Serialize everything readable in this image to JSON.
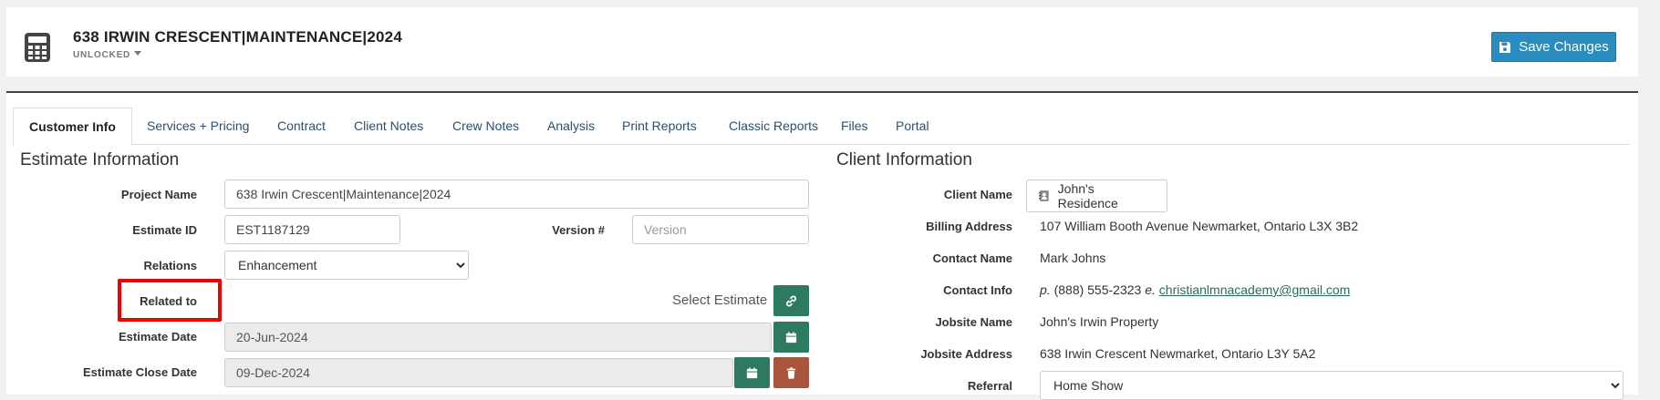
{
  "header": {
    "project_title": "638 IRWIN CRESCENT|MAINTENANCE|2024",
    "lock_status": "UNLOCKED",
    "save_label": "Save Changes"
  },
  "tabs": [
    {
      "label": "Customer Info",
      "active": true
    },
    {
      "label": "Services + Pricing"
    },
    {
      "label": "Contract"
    },
    {
      "label": "Client Notes"
    },
    {
      "label": "Crew Notes"
    },
    {
      "label": "Analysis"
    },
    {
      "label": "Print Reports"
    },
    {
      "label": "Classic Reports"
    },
    {
      "label": "Files"
    },
    {
      "label": "Portal"
    }
  ],
  "estimate": {
    "section_title": "Estimate Information",
    "project_name_label": "Project Name",
    "project_name_value": "638 Irwin Crescent|Maintenance|2024",
    "estimate_id_label": "Estimate ID",
    "estimate_id_value": "EST1187129",
    "version_label": "Version #",
    "version_placeholder": "Version",
    "relations_label": "Relations",
    "relations_value": "Enhancement",
    "related_to_label": "Related to",
    "select_estimate_label": "Select Estimate",
    "estimate_date_label": "Estimate Date",
    "estimate_date_value": "20-Jun-2024",
    "close_date_label": "Estimate Close Date",
    "close_date_value": "09-Dec-2024"
  },
  "client": {
    "section_title": "Client Information",
    "client_name_label": "Client Name",
    "client_name_value": "John's Residence",
    "billing_address_label": "Billing Address",
    "billing_address_value": "107 William Booth Avenue Newmarket, Ontario L3X 3B2",
    "contact_name_label": "Contact Name",
    "contact_name_value": "Mark Johns",
    "contact_info_label": "Contact Info",
    "phone_prefix": "p.",
    "phone_value": "(888) 555-2323",
    "email_prefix": "e.",
    "email_value": "christianlmnacademy@gmail.com",
    "jobsite_name_label": "Jobsite Name",
    "jobsite_name_value": "John's Irwin Property",
    "jobsite_address_label": "Jobsite Address",
    "jobsite_address_value": "638 Irwin Crescent Newmarket, Ontario L3Y 5A2",
    "referral_label": "Referral",
    "referral_value": "Home Show"
  },
  "colors": {
    "save_button": "#2a8bbf",
    "green_button": "#2e7a5f",
    "delete_button": "#a9553e",
    "highlight": "#ee0000"
  }
}
